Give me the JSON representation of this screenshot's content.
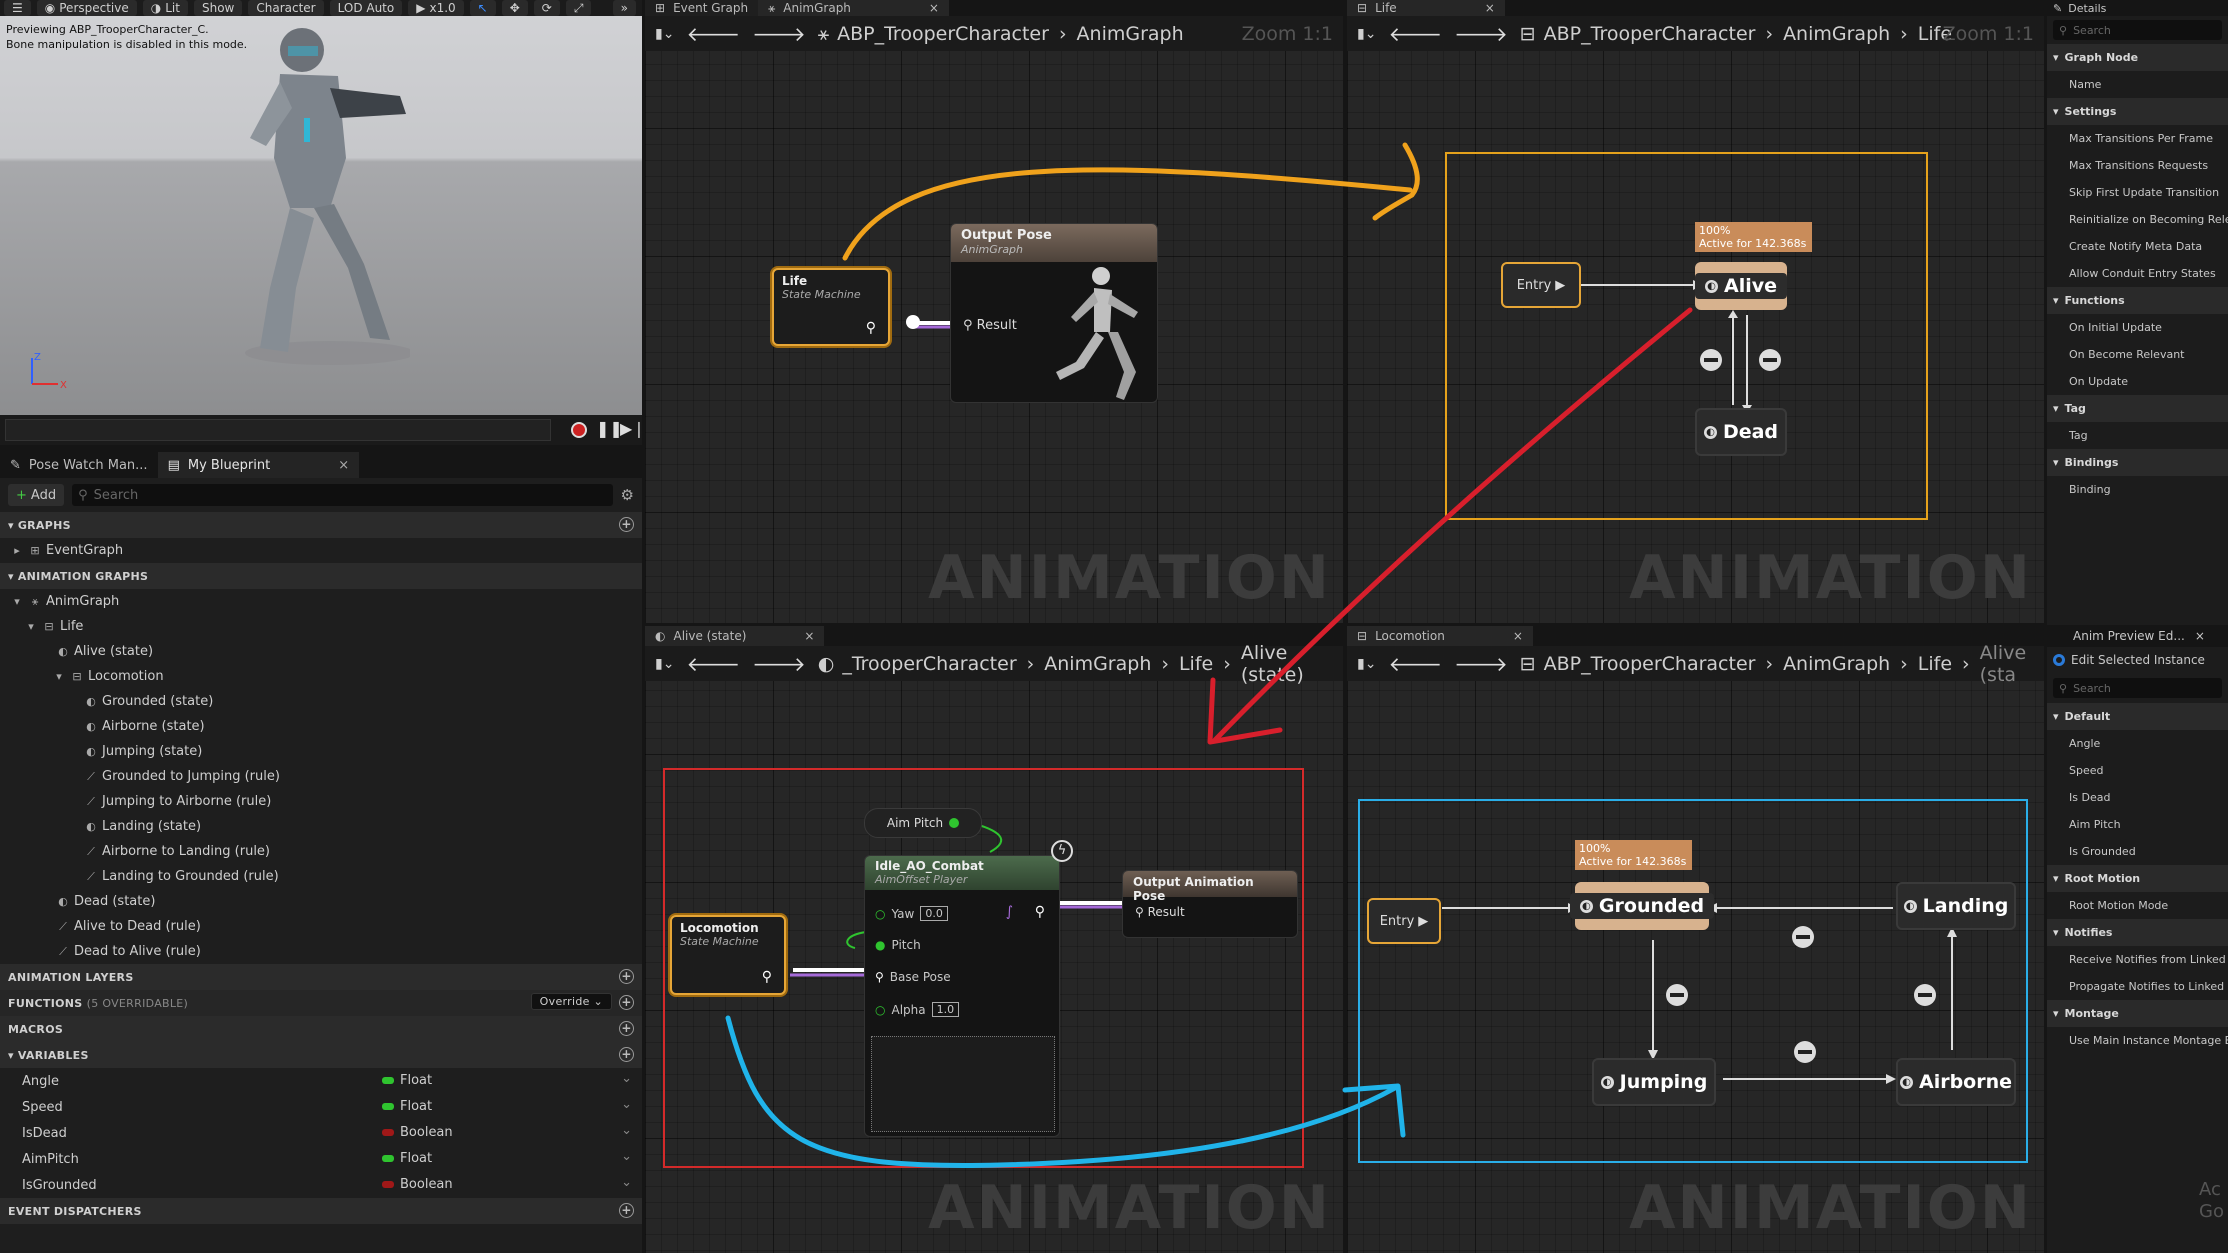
{
  "viewport": {
    "toolbar": {
      "perspective": "Perspective",
      "lit": "Lit",
      "show": "Show",
      "character": "Character",
      "lod": "LOD Auto",
      "speed": "x1.0"
    },
    "message_line1": "Previewing ABP_TrooperCharacter_C.",
    "message_line2": "Bone manipulation is disabled in this mode."
  },
  "left_panel": {
    "tabs": [
      {
        "label": "Pose Watch Man..."
      },
      {
        "label": "My Blueprint"
      }
    ],
    "add_label": "Add",
    "search_placeholder": "Search",
    "sections": {
      "graphs": "GRAPHS",
      "animation_graphs": "ANIMATION GRAPHS",
      "animation_layers": "ANIMATION LAYERS",
      "functions": "FUNCTIONS",
      "functions_count": "(5 OVERRIDABLE)",
      "override": "Override",
      "macros": "MACROS",
      "variables": "VARIABLES",
      "event_dispatchers": "EVENT DISPATCHERS"
    },
    "graphs": [
      "EventGraph"
    ],
    "anim_tree": [
      {
        "label": "AnimGraph",
        "indent": 0
      },
      {
        "label": "Life",
        "indent": 1
      },
      {
        "label": "Alive (state)",
        "indent": 2
      },
      {
        "label": "Locomotion",
        "indent": 3
      },
      {
        "label": "Grounded (state)",
        "indent": 4
      },
      {
        "label": "Airborne (state)",
        "indent": 4
      },
      {
        "label": "Jumping (state)",
        "indent": 4
      },
      {
        "label": "Grounded to Jumping (rule)",
        "indent": 4
      },
      {
        "label": "Jumping to Airborne (rule)",
        "indent": 4
      },
      {
        "label": "Landing (state)",
        "indent": 4
      },
      {
        "label": "Airborne to Landing (rule)",
        "indent": 4
      },
      {
        "label": "Landing to Grounded (rule)",
        "indent": 4
      },
      {
        "label": "Dead (state)",
        "indent": 2
      },
      {
        "label": "Alive to Dead (rule)",
        "indent": 2
      },
      {
        "label": "Dead to Alive (rule)",
        "indent": 2
      }
    ],
    "variables": [
      {
        "name": "Angle",
        "type": "Float",
        "color": "#2fc42f"
      },
      {
        "name": "Speed",
        "type": "Float",
        "color": "#2fc42f"
      },
      {
        "name": "IsDead",
        "type": "Boolean",
        "color": "#a01818"
      },
      {
        "name": "AimPitch",
        "type": "Float",
        "color": "#2fc42f"
      },
      {
        "name": "IsGrounded",
        "type": "Boolean",
        "color": "#a01818"
      }
    ]
  },
  "graph_tl": {
    "tabs": [
      "Event Graph",
      "AnimGraph"
    ],
    "breadcrumb": [
      "ABP_TrooperCharacter",
      "AnimGraph"
    ],
    "zoom": "Zoom 1:1",
    "watermark": "ANIMATION",
    "life_node": {
      "title": "Life",
      "subtitle": "State Machine"
    },
    "output_node": {
      "title": "Output Pose",
      "subtitle": "AnimGraph",
      "pin": "Result"
    }
  },
  "graph_tr": {
    "tab": "Life",
    "breadcrumb": [
      "ABP_TrooperCharacter",
      "AnimGraph",
      "Life"
    ],
    "zoom": "Zoom 1:1",
    "watermark": "ANIMATION",
    "entry": "Entry",
    "badge_line1": "100%",
    "badge_line2": "Active for 142.368s",
    "alive": "Alive",
    "dead": "Dead"
  },
  "graph_bl": {
    "tab": "Alive (state)",
    "breadcrumb": [
      "_TrooperCharacter",
      "AnimGraph",
      "Life",
      "Alive (state)"
    ],
    "watermark": "ANIMATION",
    "locomotion_node": {
      "title": "Locomotion",
      "subtitle": "State Machine"
    },
    "aim_pitch": "Aim Pitch",
    "aimoffset": {
      "title": "Idle_AO_Combat",
      "subtitle": "AimOffset Player",
      "yaw": "Yaw",
      "yaw_val": "0.0",
      "pitch": "Pitch",
      "base_pose": "Base Pose",
      "alpha": "Alpha",
      "alpha_val": "1.0"
    },
    "output_node": {
      "title": "Output Animation Pose",
      "pin": "Result"
    }
  },
  "graph_br": {
    "tab": "Locomotion",
    "breadcrumb": [
      "ABP_TrooperCharacter",
      "AnimGraph",
      "Life",
      "Alive (sta"
    ],
    "watermark": "ANIMATION",
    "entry": "Entry",
    "badge_line1": "100%",
    "badge_line2": "Active for 142.368s",
    "grounded": "Grounded",
    "landing": "Landing",
    "jumping": "Jumping",
    "airborne": "Airborne"
  },
  "details": {
    "tab": "Details",
    "search_placeholder": "Search",
    "rows": [
      {
        "t": "s",
        "label": "Graph Node"
      },
      {
        "t": "r",
        "label": "Name"
      },
      {
        "t": "s",
        "label": "Settings"
      },
      {
        "t": "r",
        "label": "Max Transitions Per Frame"
      },
      {
        "t": "r",
        "label": "Max Transitions Requests"
      },
      {
        "t": "r",
        "label": "Skip First Update Transition"
      },
      {
        "t": "r",
        "label": "Reinitialize on Becoming Relevant"
      },
      {
        "t": "r",
        "label": "Create Notify Meta Data"
      },
      {
        "t": "r",
        "label": "Allow Conduit Entry States"
      },
      {
        "t": "s",
        "label": "Functions"
      },
      {
        "t": "r",
        "label": "On Initial Update"
      },
      {
        "t": "r",
        "label": "On Become Relevant"
      },
      {
        "t": "r",
        "label": "On Update"
      },
      {
        "t": "s",
        "label": "Tag"
      },
      {
        "t": "r",
        "label": "Tag"
      },
      {
        "t": "s",
        "label": "Bindings"
      },
      {
        "t": "r",
        "label": "Binding"
      }
    ]
  },
  "preview": {
    "tab": "Anim Preview Ed...",
    "edit_label": "Edit Selected Instance",
    "search_placeholder": "Search",
    "rows": [
      {
        "t": "s",
        "label": "Default"
      },
      {
        "t": "r",
        "label": "Angle"
      },
      {
        "t": "r",
        "label": "Speed"
      },
      {
        "t": "r",
        "label": "Is Dead"
      },
      {
        "t": "r",
        "label": "Aim Pitch"
      },
      {
        "t": "r",
        "label": "Is Grounded"
      },
      {
        "t": "s",
        "label": "Root Motion"
      },
      {
        "t": "r",
        "label": "Root Motion Mode"
      },
      {
        "t": "s",
        "label": "Notifies"
      },
      {
        "t": "r",
        "label": "Receive Notifies from Linked Instances"
      },
      {
        "t": "r",
        "label": "Propagate Notifies to Linked Instances"
      },
      {
        "t": "s",
        "label": "Montage"
      },
      {
        "t": "r",
        "label": "Use Main Instance Montage Evaluation"
      }
    ],
    "corner_text_1": "Ac",
    "corner_text_2": "Go"
  }
}
